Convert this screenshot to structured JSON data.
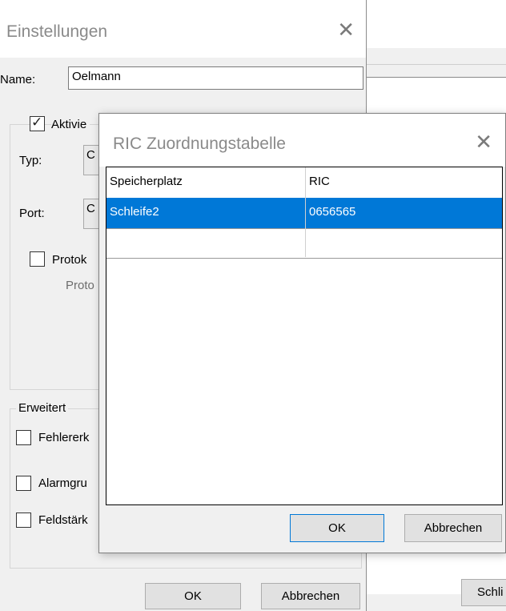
{
  "settings_dialog": {
    "title": "Einstellungen",
    "name_label": "Name:",
    "name_value": "Oelmann",
    "activate_label": "Aktivie",
    "type_label": "Typ:",
    "type_value": "C",
    "port_label": "Port:",
    "port_value": "C",
    "protocol_label": "Protok",
    "protocol_sub": "Proto",
    "advanced_label": "Erweitert",
    "error_label": "Fehlererk",
    "alarm_label": "Alarmgru",
    "field_label": "Feldstärk",
    "ok": "OK",
    "cancel": "Abbrechen"
  },
  "background_window": {
    "button_label": "Schli"
  },
  "ric_dialog": {
    "title": "RIC Zuordnungstabelle",
    "columns": [
      "Speicherplatz",
      "RIC"
    ],
    "rows": [
      [
        "Schleife2",
        "0656565"
      ]
    ],
    "ok": "OK",
    "cancel": "Abbrechen"
  },
  "icons": {
    "close": "close-icon",
    "check": "check-icon"
  }
}
